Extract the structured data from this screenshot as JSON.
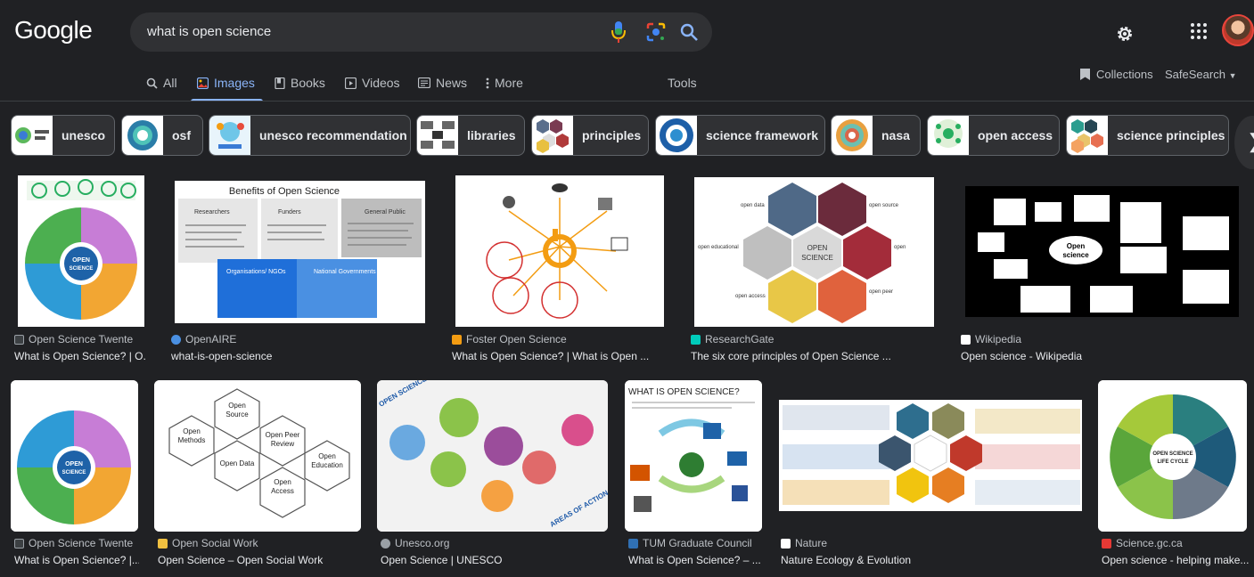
{
  "header": {
    "logo": "Google",
    "query": "what is open science"
  },
  "tabs": [
    {
      "label": "All"
    },
    {
      "label": "Images"
    },
    {
      "label": "Books"
    },
    {
      "label": "Videos"
    },
    {
      "label": "News"
    },
    {
      "label": "More"
    }
  ],
  "tools_label": "Tools",
  "collections_label": "Collections",
  "safesearch_label": "SafeSearch",
  "chips": [
    {
      "label": "unesco"
    },
    {
      "label": "osf"
    },
    {
      "label": "unesco recommendation"
    },
    {
      "label": "libraries"
    },
    {
      "label": "principles"
    },
    {
      "label": "science framework"
    },
    {
      "label": "nasa"
    },
    {
      "label": "open access"
    },
    {
      "label": "science principles"
    }
  ],
  "results": [
    {
      "source": "Open Science Twente",
      "title": "What is Open Science? | O...",
      "favicon_color": "#3c4043"
    },
    {
      "source": "OpenAIRE",
      "title": "what-is-open-science",
      "favicon_color": "#4a90e2"
    },
    {
      "source": "Foster Open Science",
      "title": "What is Open Science? | What is Open ...",
      "favicon_color": "#f39c12"
    },
    {
      "source": "ResearchGate",
      "title": "The six core principles of Open Science ...",
      "favicon_color": "#00ccbb"
    },
    {
      "source": "Wikipedia",
      "title": "Open science - Wikipedia",
      "favicon_color": "#ffffff"
    },
    {
      "source": "Open Science Twente",
      "title": "What is Open Science? |...",
      "favicon_color": "#3c4043"
    },
    {
      "source": "Open Social Work",
      "title": "Open Science – Open Social Work",
      "favicon_color": "#f0c040"
    },
    {
      "source": "Unesco.org",
      "title": "Open Science | UNESCO",
      "favicon_color": "#9aa0a6"
    },
    {
      "source": "TUM Graduate Council",
      "title": "What is Open Science? – ...",
      "favicon_color": "#3070b3"
    },
    {
      "source": "Nature",
      "title": "Nature Ecology & Evolution",
      "favicon_color": "#ffffff"
    },
    {
      "source": "Science.gc.ca",
      "title": "Open science - helping make...",
      "favicon_color": "#e53935"
    }
  ],
  "image_text": {
    "benefits_title": "Benefits of Open Science",
    "benefits_researchers": "Researchers",
    "benefits_funders": "Funders",
    "benefits_general": "General Public",
    "benefits_orgs": "Organisations/ NGOs",
    "benefits_gov": "National Governments",
    "open_science": "OPEN SCIENCE",
    "rg_open_data": "open data",
    "rg_open_source": "open source",
    "rg_oer": "open educational resources",
    "rg_methodology": "open methodology",
    "rg_access": "open access",
    "rg_peer": "open peer review",
    "wiki_center": "Open science",
    "osw_source": "Open Source",
    "osw_methods": "Open Methods",
    "osw_peer": "Open Peer Review",
    "osw_data": "Open Data",
    "osw_edu": "Open Education",
    "osw_access": "Open Access",
    "unesco_title": "OPEN SCIENCE",
    "unesco_areas": "AREAS OF ACTION",
    "tum_title": "WHAT IS OPEN SCIENCE?",
    "gc_center": "OPEN SCIENCE LIFE CYCLE"
  }
}
